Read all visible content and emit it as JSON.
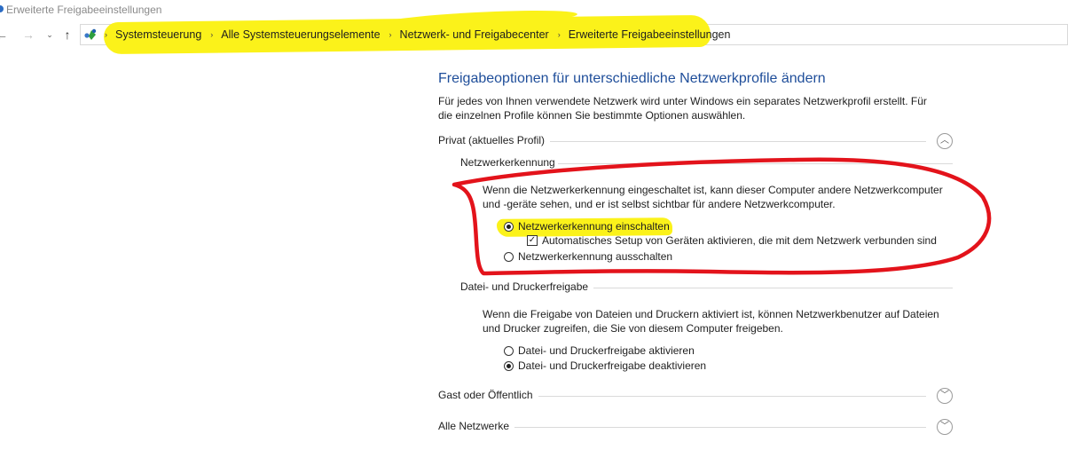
{
  "window": {
    "title": "Erweiterte Freigabeeinstellungen"
  },
  "nav": {
    "back_icon": "←",
    "forward_icon": "→",
    "recent_icon": "⌄",
    "up_icon": "↑",
    "separator": "›"
  },
  "breadcrumbs": [
    "Systemsteuerung",
    "Alle Systemsteuerungselemente",
    "Netzwerk- und Freigabecenter",
    "Erweiterte Freigabeeinstellungen"
  ],
  "page": {
    "title": "Freigabeoptionen für unterschiedliche Netzwerkprofile ändern",
    "description": "Für jedes von Ihnen verwendete Netzwerk wird unter Windows ein separates Netzwerkprofil erstellt. Für die einzelnen Profile können Sie bestimmte Optionen auswählen."
  },
  "profiles": {
    "private": {
      "label": "Privat (aktuelles Profil)",
      "chevron": "︿"
    },
    "guest": {
      "label": "Gast oder Öffentlich",
      "chevron": "﹀"
    },
    "all": {
      "label": "Alle Netzwerke",
      "chevron": "﹀"
    }
  },
  "network_discovery": {
    "heading": "Netzwerkerkennung",
    "description": "Wenn die Netzwerkerkennung eingeschaltet ist, kann dieser Computer andere Netzwerkcomputer und -geräte sehen, und er ist selbst sichtbar für andere Netzwerkcomputer.",
    "option_on": "Netzwerkerkennung einschalten",
    "auto_setup": "Automatisches Setup von Geräten aktivieren, die mit dem Netzwerk verbunden sind",
    "option_off": "Netzwerkerkennung ausschalten",
    "selected": "on",
    "auto_setup_checked": true,
    "check_mark": "✓"
  },
  "file_printer_sharing": {
    "heading": "Datei- und Druckerfreigabe",
    "description": "Wenn die Freigabe von Dateien und Druckern aktiviert ist, können Netzwerkbenutzer auf Dateien und Drucker zugreifen, die Sie von diesem Computer freigeben.",
    "option_on": "Datei- und Druckerfreigabe aktivieren",
    "option_off": "Datei- und Druckerfreigabe deaktivieren",
    "selected": "off"
  },
  "colors": {
    "title_blue": "#1f4e9a",
    "highlight_yellow": "#fbf21a",
    "annotation_red": "#e3131b"
  }
}
